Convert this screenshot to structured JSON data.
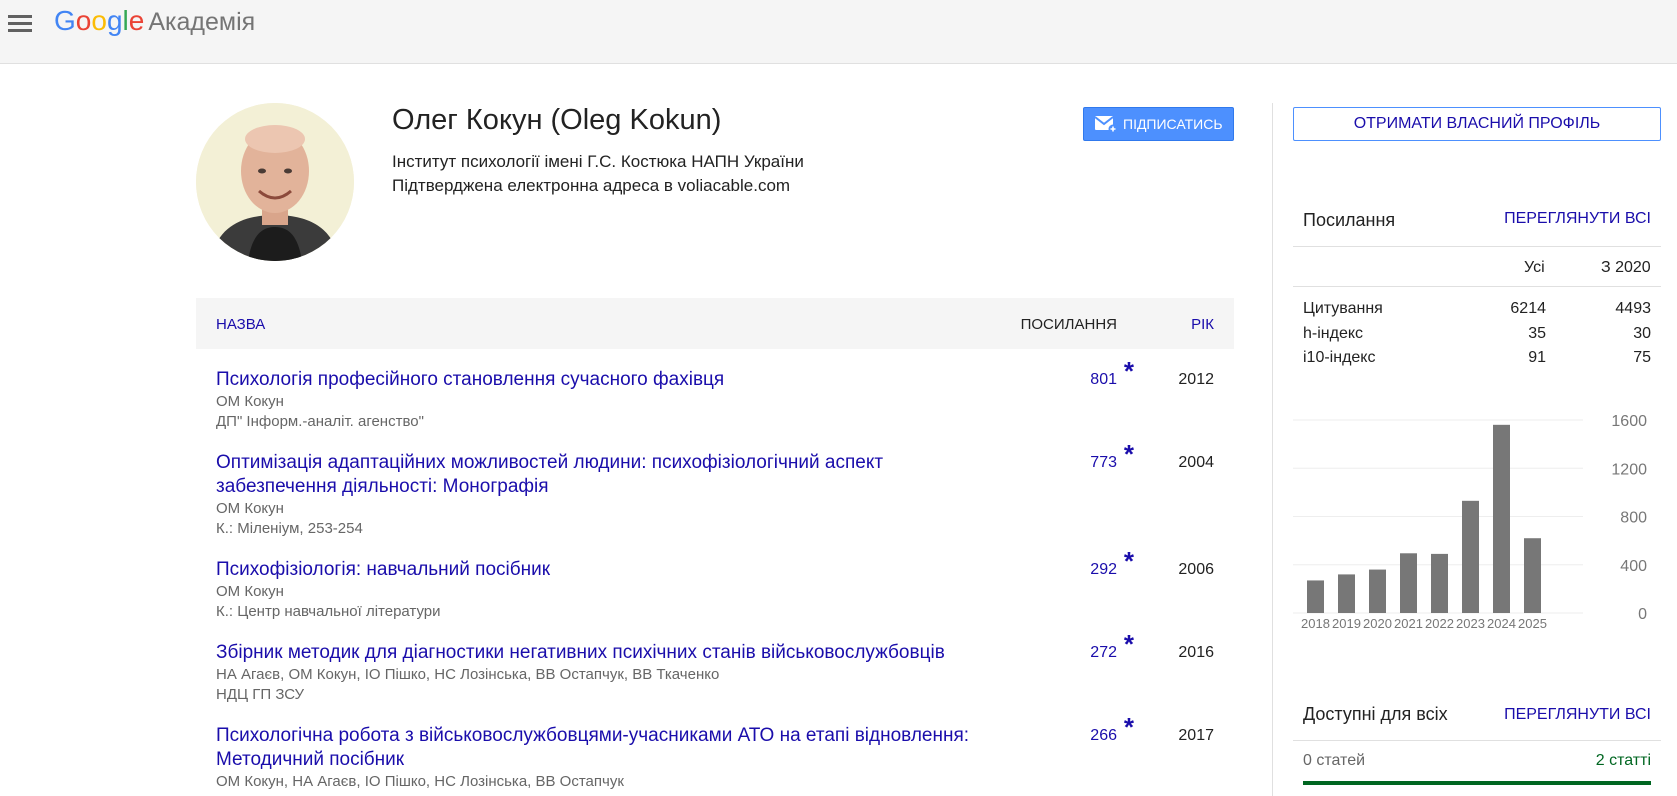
{
  "header": {
    "logo_letters": [
      "G",
      "o",
      "o",
      "g",
      "l",
      "e"
    ],
    "logo_suffix": "Академія"
  },
  "profile": {
    "name": "Олег Кокун (Oleg Kokun)",
    "affiliation": "Інститут психології імені Г.С. Костюка НАПН України",
    "email": "Підтверджена електронна адреса в voliacable.com",
    "follow_label": "ПІДПИСАТИСЬ"
  },
  "table": {
    "col_title": "НАЗВА",
    "col_cites": "ПОСИЛАННЯ",
    "col_year": "РІК",
    "rows": [
      {
        "title": "Психологія професійного становлення сучасного фахівця",
        "authors": "ОМ Кокун",
        "venue": "ДП\" Інформ.-аналіт. агенство\"",
        "cites": "801",
        "star": "*",
        "year": "2012"
      },
      {
        "title": "Оптимізація адаптаційних можливостей людини: психофізіологічний аспект забезпечення діяльності: Монографія",
        "authors": "ОМ Кокун",
        "venue": "К.: Міленіум, 253-254",
        "cites": "773",
        "star": "*",
        "year": "2004"
      },
      {
        "title": "Психофізіологія: навчальний посібник",
        "authors": "ОМ Кокун",
        "venue": "К.: Центр навчальної літератури",
        "cites": "292",
        "star": "*",
        "year": "2006"
      },
      {
        "title": "Збірник методик для діагностики негативних психічних станів військовослужбовців",
        "authors": "НА Агаєв, ОМ Кокун, ІО Пішко, НС Лозінська, ВВ Остапчук, ВВ Ткаченко",
        "venue": "НДЦ ГП ЗСУ",
        "cites": "272",
        "star": "*",
        "year": "2016"
      },
      {
        "title": "Психологічна робота з військовослужбовцями-учасниками АТО на етапі відновлення: Методичний посібник",
        "authors": "ОМ Кокун, НА Агаєв, ІО Пішко, НС Лозінська, ВВ Остапчук",
        "venue": "",
        "cites": "266",
        "star": "*",
        "year": "2017"
      }
    ]
  },
  "sidebar": {
    "own_profile_label": "ОТРИМАТИ ВЛАСНИЙ ПРОФІЛЬ",
    "citations": {
      "title": "Посилання",
      "view_all": "ПЕРЕГЛЯНУТИ ВСІ",
      "hdr_all": "Усі",
      "hdr_since": "З 2020",
      "rows": [
        {
          "label": "Цитування",
          "all": "6214",
          "since": "4493"
        },
        {
          "label": "h-індекс",
          "all": "35",
          "since": "30"
        },
        {
          "label": "i10-індекс",
          "all": "91",
          "since": "75"
        }
      ]
    },
    "open_access": {
      "title": "Доступні для всіх",
      "view_all": "ПЕРЕГЛЯНУТИ ВСІ",
      "unavailable": "0 статей",
      "available": "2 статті",
      "available_fraction": 1.0
    }
  },
  "chart_data": {
    "type": "bar",
    "categories": [
      "2018",
      "2019",
      "2020",
      "2021",
      "2022",
      "2023",
      "2024",
      "2025"
    ],
    "values": [
      270,
      320,
      360,
      495,
      490,
      930,
      1560,
      620
    ],
    "yticks": [
      "0",
      "400",
      "800",
      "1200",
      "1600"
    ],
    "ylim": [
      0,
      1600
    ],
    "grid": true,
    "bar_color": "#777777"
  }
}
